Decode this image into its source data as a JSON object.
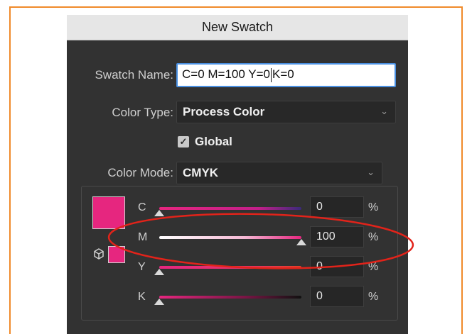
{
  "dialog": {
    "title": "New Swatch",
    "swatch_name_label": "Swatch Name:",
    "swatch_name_before_caret": "C=0 M=100 Y=0",
    "swatch_name_after_caret": "K=0",
    "color_type_label": "Color Type:",
    "color_type_value": "Process Color",
    "global_checked": true,
    "global_label": "Global",
    "color_mode_label": "Color Mode:",
    "color_mode_value": "CMYK",
    "swatch_color": "#e6267f",
    "channels": [
      {
        "label": "C",
        "value": "0",
        "unit": "%"
      },
      {
        "label": "M",
        "value": "100",
        "unit": "%"
      },
      {
        "label": "Y",
        "value": "0",
        "unit": "%"
      },
      {
        "label": "K",
        "value": "0",
        "unit": "%"
      }
    ]
  },
  "colors": {
    "border_accent": "#f08a2a",
    "annotation": "#e2231a",
    "magenta": "#e6267f"
  },
  "icons": {
    "dropdown": "chevron-down-icon",
    "checkbox": "checkmark-icon",
    "gamut": "cube-icon"
  }
}
